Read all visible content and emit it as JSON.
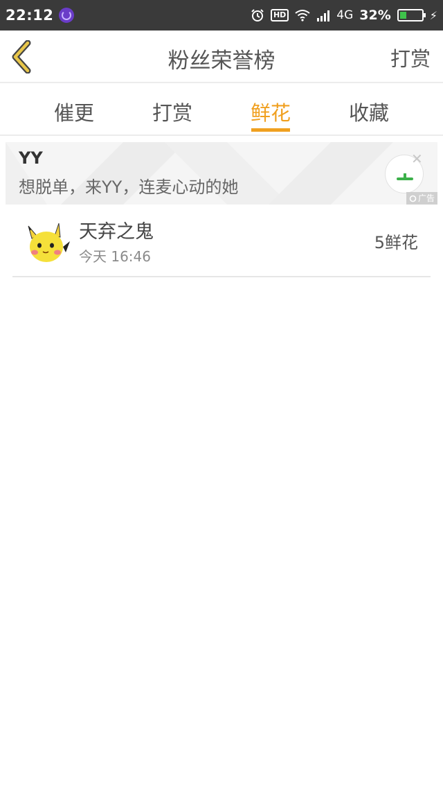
{
  "status_bar": {
    "time": "22:12",
    "hd": "HD",
    "network": "4G",
    "battery": "32%",
    "battery_level": 0.32,
    "icons": [
      "alarm-icon",
      "hd-icon",
      "wifi-icon",
      "signal-icon",
      "battery-icon",
      "charging-icon"
    ]
  },
  "header": {
    "title": "粉丝荣誉榜",
    "action_label": "打赏",
    "back_icon": "chevron-left-icon",
    "back_icon_color": "#e8c64a"
  },
  "tabs": [
    {
      "label": "催更",
      "active": false
    },
    {
      "label": "打赏",
      "active": false
    },
    {
      "label": "鲜花",
      "active": true
    },
    {
      "label": "收藏",
      "active": false
    }
  ],
  "ad": {
    "title": "YY",
    "description": "想脱单，来YY，连麦心动的她",
    "tag": "广告",
    "close_icon": "close-icon"
  },
  "list": [
    {
      "name": "天弃之鬼",
      "time": "今天 16:46",
      "count": "5鲜花",
      "avatar_icon": "pikachu-avatar"
    }
  ],
  "colors": {
    "accent": "#f0a020",
    "status_bar": "#3a3a3a",
    "divider": "#ececec"
  }
}
